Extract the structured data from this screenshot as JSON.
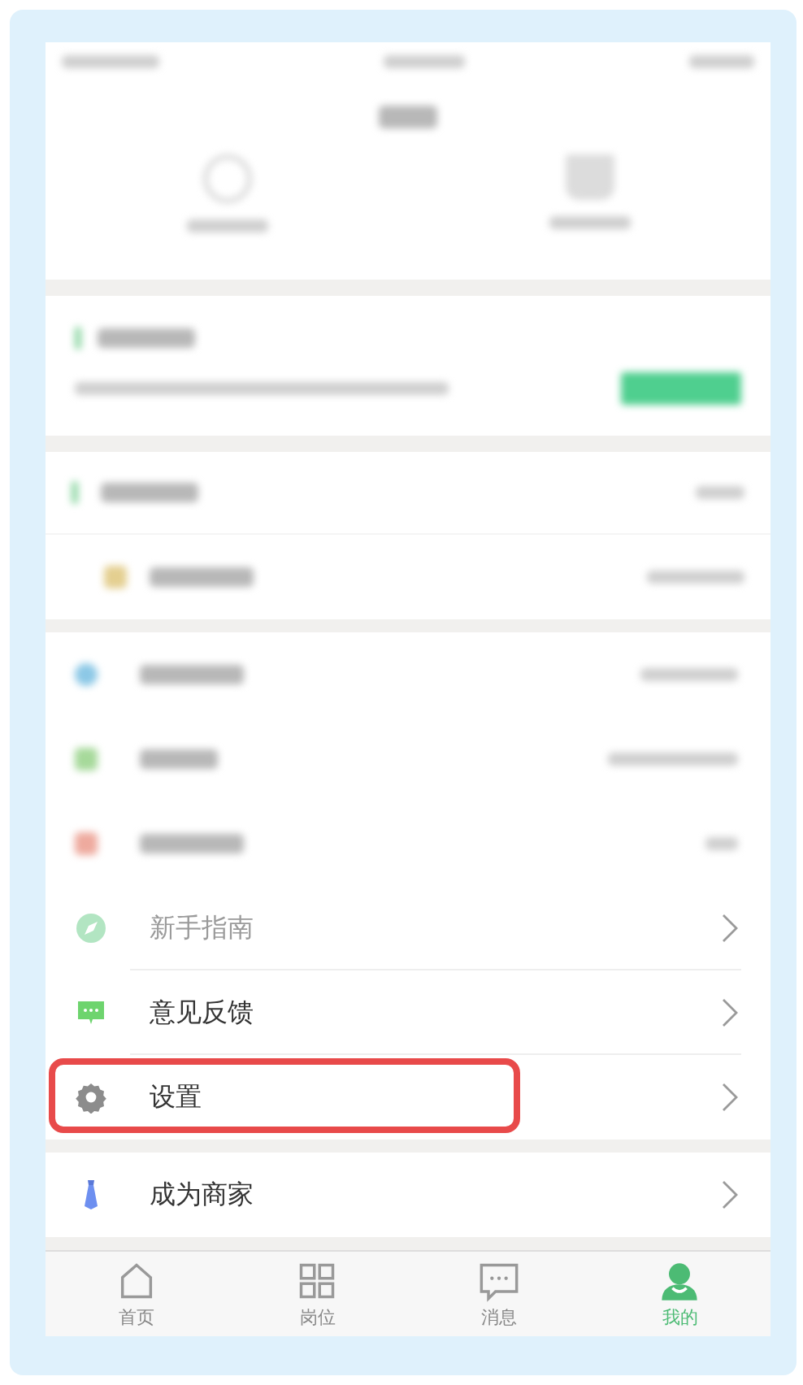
{
  "menu": [
    {
      "label": "新手指南",
      "faded": true,
      "highlighted": false
    },
    {
      "label": "意见反馈",
      "faded": false,
      "highlighted": false
    },
    {
      "label": "设置",
      "faded": false,
      "highlighted": true
    }
  ],
  "extra_menu": [
    {
      "label": "成为商家"
    }
  ],
  "tabs": [
    {
      "label": "首页",
      "selected": false
    },
    {
      "label": "岗位",
      "selected": false
    },
    {
      "label": "消息",
      "selected": false
    },
    {
      "label": "我的",
      "selected": true
    }
  ]
}
